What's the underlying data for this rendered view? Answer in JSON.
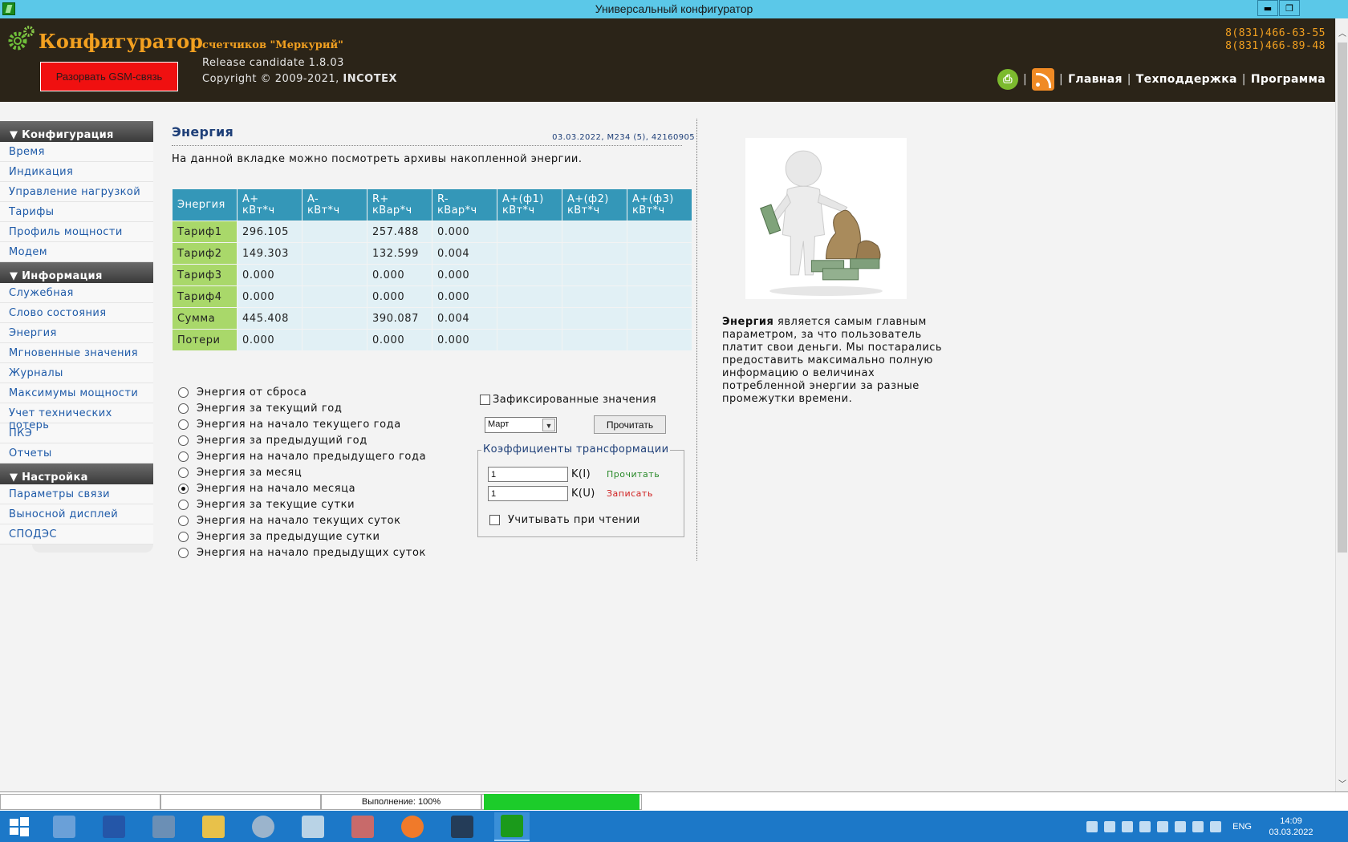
{
  "window": {
    "title": "Универсальный конфигуратор",
    "buttons": [
      "▬",
      "❐",
      "✕"
    ]
  },
  "header": {
    "brand": "Конфигуратор",
    "subtitle": "счетчиков \"Меркурий\"",
    "gsm_button": "Разорвать GSM-связь",
    "release": "Release candidate 1.8.03",
    "copyright_prefix": "Copyright © 2009-2021, ",
    "copyright_company": "INCOTEX",
    "phones": [
      "8(831)466-63-55",
      "8(831)466-89-48"
    ],
    "links": [
      "Главная",
      "Техподдержка",
      "Программа"
    ],
    "separator": "|",
    "print_icon_glyph": "⎙",
    "icons": [
      "print-icon",
      "rss-icon",
      "gears-icon"
    ]
  },
  "sidebar": {
    "sections": [
      {
        "title": "▼ Конфигурация",
        "items": [
          "Время",
          "Индикация",
          "Управление нагрузкой",
          "Тарифы",
          "Профиль мощности",
          "Модем"
        ]
      },
      {
        "title": "▼ Информация",
        "items": [
          "Служебная",
          "Слово состояния",
          "Энергия",
          "Мгновенные значения",
          "Журналы",
          "Максимумы мощности",
          "Учет технических потерь",
          "ПКЭ",
          "Отчеты"
        ]
      },
      {
        "title": "▼ Настройка",
        "items": [
          "Параметры связи",
          "Выносной дисплей",
          "СПОДЭС"
        ]
      }
    ]
  },
  "main": {
    "title": "Энергия",
    "meta": "03.03.2022, M234 (5), 42160905",
    "description": "На данной вкладке можно посмотреть архивы накопленной энергии.",
    "table": {
      "headers": [
        "Энергия",
        "A+\nкВт*ч",
        "A-\nкВт*ч",
        "R+\nкВар*ч",
        "R-\nкВар*ч",
        "A+(ф1)\nкВт*ч",
        "A+(ф2)\nкВт*ч",
        "A+(ф3)\nкВт*ч"
      ],
      "rows": [
        [
          "Тариф1",
          "296.105",
          "",
          "257.488",
          "0.000",
          "",
          "",
          ""
        ],
        [
          "Тариф2",
          "149.303",
          "",
          "132.599",
          "0.004",
          "",
          "",
          ""
        ],
        [
          "Тариф3",
          "0.000",
          "",
          "0.000",
          "0.000",
          "",
          "",
          ""
        ],
        [
          "Тариф4",
          "0.000",
          "",
          "0.000",
          "0.000",
          "",
          "",
          ""
        ],
        [
          "Сумма",
          "445.408",
          "",
          "390.087",
          "0.004",
          "",
          "",
          ""
        ],
        [
          "Потери",
          "0.000",
          "",
          "0.000",
          "0.000",
          "",
          "",
          ""
        ]
      ]
    },
    "radio_options": [
      {
        "label": "Энергия от сброса",
        "checked": false
      },
      {
        "label": "Энергия за текущий год",
        "checked": false
      },
      {
        "label": "Энергия на начало текущего года",
        "checked": false
      },
      {
        "label": "Энергия за предыдущий год",
        "checked": false
      },
      {
        "label": "Энергия на начало предыдущего года",
        "checked": false
      },
      {
        "label": "Энергия за месяц",
        "checked": false
      },
      {
        "label": "Энергия на начало месяца",
        "checked": true
      },
      {
        "label": "Энергия за текущие сутки",
        "checked": false
      },
      {
        "label": "Энергия на начало текущих суток",
        "checked": false
      },
      {
        "label": "Энергия за предыдущие сутки",
        "checked": false
      },
      {
        "label": "Энергия на начало предыдущих суток",
        "checked": false
      }
    ],
    "fixed_values_label": "Зафиксированные значения",
    "month_selected": "Март",
    "read_button": "Прочитать",
    "coefficients": {
      "legend": "Коэффициенты трансформации",
      "ki_value": "1",
      "ki_label": "K(I)",
      "ku_value": "1",
      "ku_label": "K(U)",
      "read_link": "Прочитать",
      "write_link": "Записать",
      "apply_label": "Учитывать при чтении"
    }
  },
  "info": {
    "bold": "Энергия",
    "text": " является самым главным параметром, за что пользователь платит свои деньги. Мы постарались предоставить максимально полную информацию о величинах потребленной энергии за разные промежутки времени."
  },
  "statusbar": {
    "progress_text": "Выполнение: 100%",
    "progress": 1.0
  },
  "taskbar": {
    "lang": "ENG",
    "time": "14:09",
    "date": "03.03.2022",
    "apps": [
      "windows-start",
      "server-manager",
      "powershell",
      "toolbox",
      "file-explorer",
      "settings",
      "notepad",
      "archive",
      "firefox",
      "grid-app",
      "configurator"
    ]
  },
  "colors": {
    "titlebar": "#5bc8e8",
    "header_bg": "#2b2418",
    "brand_orange": "#f2a020",
    "table_header": "#3497b8",
    "row_label": "#a9d86a",
    "cell_bg": "#e1f0f5",
    "progress_green": "#1ccc2a",
    "taskbar": "#1c78c8"
  }
}
